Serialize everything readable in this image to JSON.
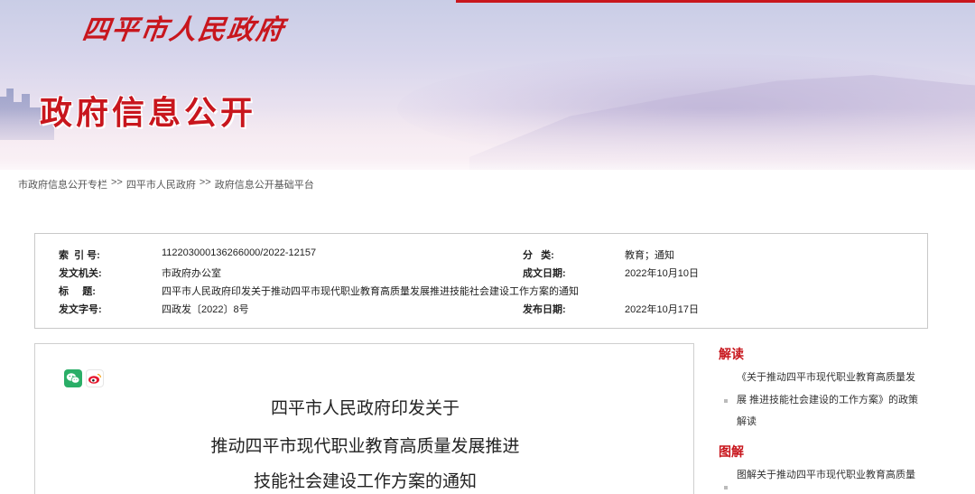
{
  "banner": {
    "site_name": "四平市人民政府",
    "section_title": "政府信息公开",
    "accent_color": "#c8161d"
  },
  "breadcrumb": {
    "items": [
      "市政府信息公开专栏",
      "四平市人民政府",
      "政府信息公开基础平台"
    ],
    "separator": ">>"
  },
  "info": {
    "index_label": "索  引 号:",
    "index_value": "112203000136266000/2022-12157",
    "category_label": "分   类:",
    "category_value": "教育；通知",
    "issuer_label": "发文机关:",
    "issuer_value": "市政府办公室",
    "created_label": "成文日期:",
    "created_value": "2022年10月10日",
    "title_label": "标     题:",
    "title_value": "四平市人民政府印发关于推动四平市现代职业教育高质量发展推进技能社会建设工作方案的通知",
    "docno_label": "发文字号:",
    "docno_value": "四政发〔2022〕8号",
    "published_label": "发布日期:",
    "published_value": "2022年10月17日"
  },
  "article": {
    "share_icons": [
      "wechat-icon",
      "weibo-icon"
    ],
    "title_lines": [
      "四平市人民政府印发关于",
      "推动四平市现代职业教育高质量发展推进",
      "技能社会建设工作方案的通知"
    ]
  },
  "sidebar": {
    "interpretation_heading": "解读",
    "interpretation_text": "《关于推动四平市现代职业教育高质量发展 推进技能社会建设的工作方案》的政策解读",
    "graphic_heading": "图解",
    "graphic_text": "图解关于推动四平市现代职业教育高质量"
  }
}
